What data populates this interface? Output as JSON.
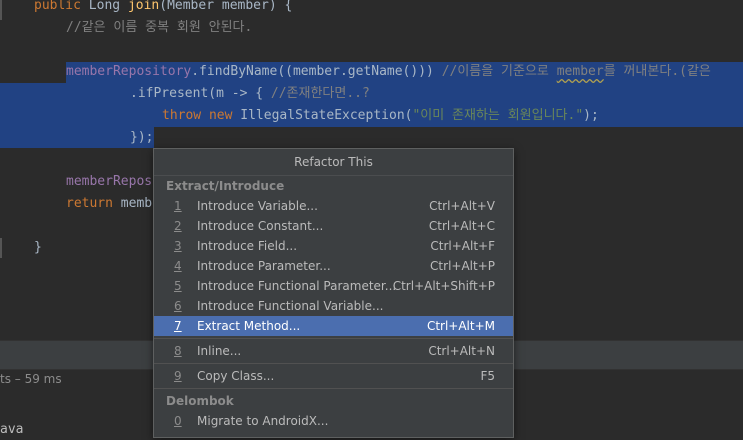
{
  "editor": {
    "lines": [
      {
        "segments": [
          {
            "t": "public ",
            "c": "kw"
          },
          {
            "t": "Long ",
            "c": "cls"
          },
          {
            "t": "join",
            "c": "fn"
          },
          {
            "t": "(Member member) {",
            "c": "cls"
          }
        ]
      },
      {
        "segments": [
          {
            "t": "//같은 이름 중복 회원 안된다.",
            "c": "cm"
          }
        ]
      },
      {
        "segments": []
      },
      {
        "segments": [
          {
            "t": "memberRepository",
            "c": "fld"
          },
          {
            "t": ".findByName((member.getName())) ",
            "c": "cls"
          },
          {
            "t": "//이름을 기준으로 ",
            "c": "cm"
          },
          {
            "t": "member",
            "c": "cm ul"
          },
          {
            "t": "를 꺼내본다.(같은",
            "c": "cm"
          }
        ]
      },
      {
        "segments": [
          {
            "t": ".ifPresent(m -> { ",
            "c": "cls"
          },
          {
            "t": "//존재한다면..?",
            "c": "cm"
          }
        ]
      },
      {
        "segments": [
          {
            "t": "throw new ",
            "c": "kw"
          },
          {
            "t": "IllegalStateException(",
            "c": "cls"
          },
          {
            "t": "\"이미 존재하는 회원입니다.\"",
            "c": "str"
          },
          {
            "t": ");",
            "c": "cls"
          }
        ]
      },
      {
        "segments": [
          {
            "t": "});",
            "c": "cls"
          }
        ]
      },
      {
        "segments": []
      },
      {
        "segments": [
          {
            "t": "memberRepos",
            "c": "fld"
          }
        ]
      },
      {
        "segments": [
          {
            "t": "return ",
            "c": "kw"
          },
          {
            "t": "memb",
            "c": "cls"
          }
        ]
      },
      {
        "segments": []
      },
      {
        "segments": [
          {
            "t": "}",
            "c": "cls"
          }
        ]
      }
    ]
  },
  "status": {
    "elapsed": "ts – 59 ms"
  },
  "bottom": {
    "file_fragment": "ava"
  },
  "popup": {
    "title": "Refactor This",
    "groups": [
      {
        "name": "Extract/Introduce",
        "items": [
          {
            "num": "1",
            "label": "Introduce Variable...",
            "shortcut": "Ctrl+Alt+V"
          },
          {
            "num": "2",
            "label": "Introduce Constant...",
            "shortcut": "Ctrl+Alt+C"
          },
          {
            "num": "3",
            "label": "Introduce Field...",
            "shortcut": "Ctrl+Alt+F"
          },
          {
            "num": "4",
            "label": "Introduce Parameter...",
            "shortcut": "Ctrl+Alt+P"
          },
          {
            "num": "5",
            "label": "Introduce Functional Parameter...",
            "shortcut": "Ctrl+Alt+Shift+P"
          },
          {
            "num": "6",
            "label": "Introduce Functional Variable...",
            "shortcut": ""
          },
          {
            "num": "7",
            "label": "Extract Method...",
            "shortcut": "Ctrl+Alt+M",
            "selected": true
          }
        ]
      },
      {
        "name": "",
        "items": [
          {
            "num": "8",
            "label": "Inline...",
            "shortcut": "Ctrl+Alt+N"
          }
        ]
      },
      {
        "name": "",
        "items": [
          {
            "num": "9",
            "label": "Copy Class...",
            "shortcut": "F5"
          }
        ]
      },
      {
        "name": "Delombok",
        "items": [
          {
            "num": "0",
            "label": "Migrate to AndroidX...",
            "shortcut": ""
          }
        ]
      }
    ]
  }
}
